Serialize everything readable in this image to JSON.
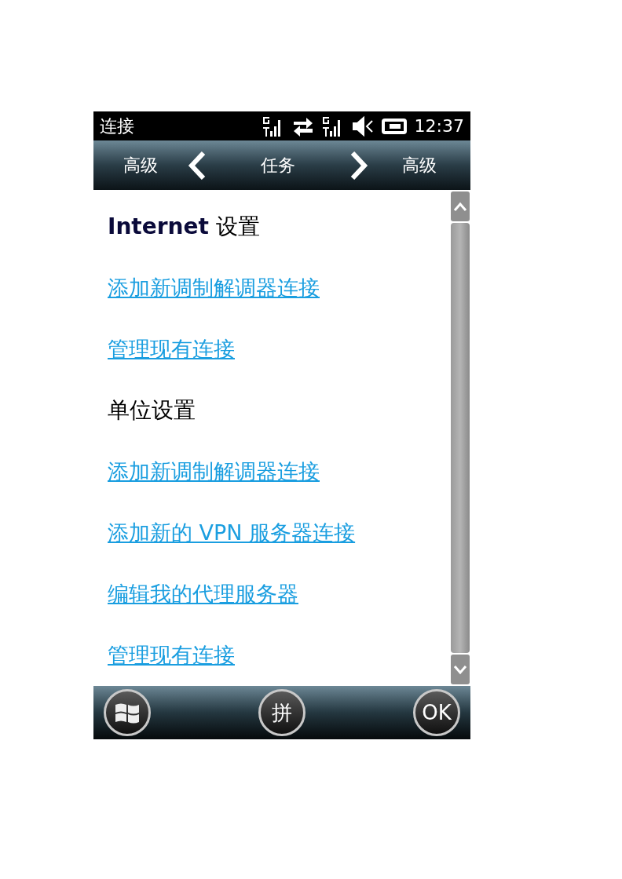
{
  "status_bar": {
    "title": "连接",
    "time": "12:37"
  },
  "nav": {
    "left": "高级",
    "center": "任务",
    "right": "高级"
  },
  "items": [
    {
      "kind": "heading",
      "text": "**Internet** 设置"
    },
    {
      "kind": "link",
      "text": "添加新调制解调器连接"
    },
    {
      "kind": "link",
      "text": "管理现有连接"
    },
    {
      "kind": "heading",
      "text": "单位设置"
    },
    {
      "kind": "link",
      "text": "添加新调制解调器连接"
    },
    {
      "kind": "link",
      "text": "添加新的 VPN 服务器连接"
    },
    {
      "kind": "link",
      "text": "编辑我的代理服务器"
    },
    {
      "kind": "link",
      "text": "管理现有连接"
    }
  ],
  "softkeys": [
    {
      "kind": "start"
    },
    {
      "kind": "text",
      "label": "拼"
    },
    {
      "kind": "text",
      "label": "OK"
    }
  ]
}
